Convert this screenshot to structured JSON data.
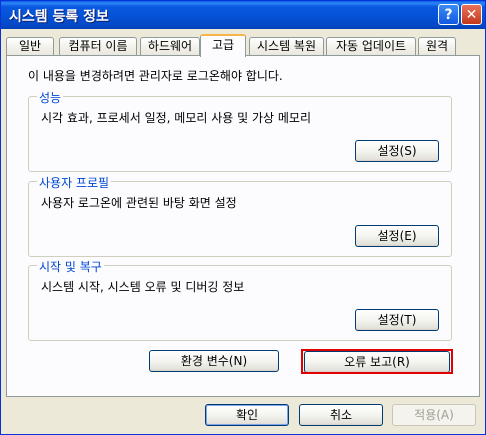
{
  "window": {
    "title": "시스템 등록 정보",
    "help_glyph": "?",
    "close_glyph": "✕"
  },
  "tabs": [
    {
      "label": "일반"
    },
    {
      "label": "컴퓨터 이름"
    },
    {
      "label": "하드웨어"
    },
    {
      "label": "고급",
      "active": true
    },
    {
      "label": "시스템 복원"
    },
    {
      "label": "자동 업데이트"
    },
    {
      "label": "원격"
    }
  ],
  "notice": "이 내용을 변경하려면 관리자로 로그온해야 합니다.",
  "groups": {
    "performance": {
      "legend": "성능",
      "desc": "시각 효과, 프로세서 일정, 메모리 사용 및 가상 메모리",
      "button": "설정(S)"
    },
    "user_profiles": {
      "legend": "사용자 프로필",
      "desc": "사용자 로그온에 관련된 바탕 화면 설정",
      "button": "설정(E)"
    },
    "startup_recovery": {
      "legend": "시작 및 복구",
      "desc": "시스템 시작, 시스템 오류 및 디버깅 정보",
      "button": "설정(T)"
    }
  },
  "env_button": "환경 변수(N)",
  "error_report_button": "오류 보고(R)",
  "footer": {
    "ok": "확인",
    "cancel": "취소",
    "apply": "적용(A)"
  },
  "colors": {
    "titlebar": "#0553d8",
    "legend": "#0046d5",
    "highlight": "#e00000"
  }
}
